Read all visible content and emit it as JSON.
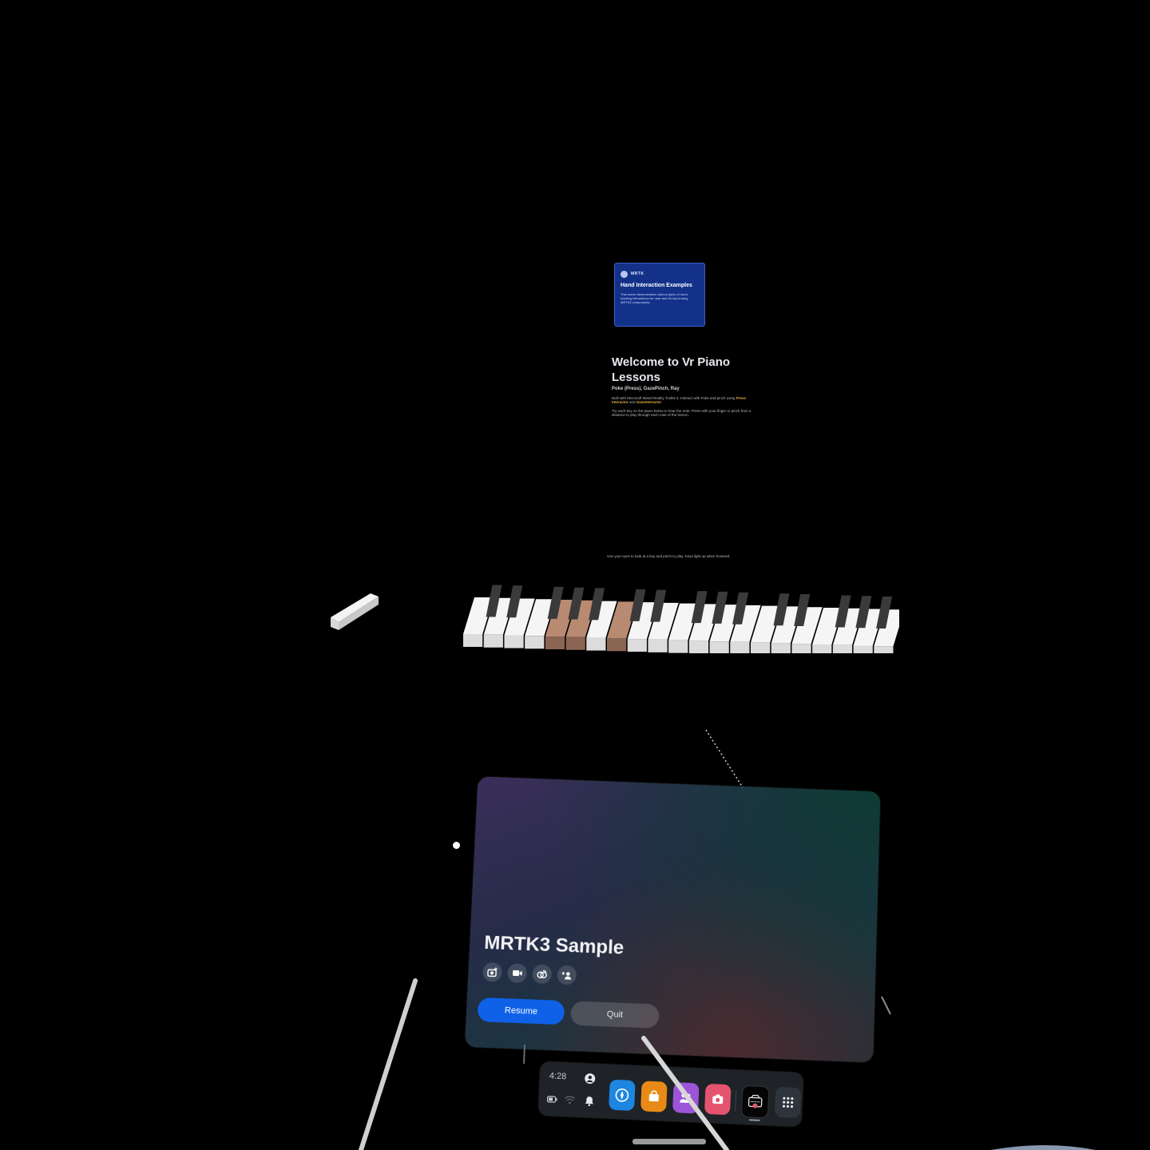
{
  "mrtk_card": {
    "brand": "MRTK",
    "title": "Hand Interaction Examples",
    "body": "This scene demonstrates various types of hand tracking interactions for near and far input using MRTK3 components."
  },
  "welcome": {
    "title": "Welcome to Vr Piano Lessons",
    "subtitle": "Poke (Press), GazePinch, Ray",
    "para1_a": "Built with Microsoft Mixed Reality Toolkit 3. Interact with Poke and pinch using ",
    "para1_link1": "Press Interactor",
    "para1_and": " and ",
    "para1_link2": "GazeInteractor",
    "para2": "Try each key on the piano below to hear the note. Press with your finger or pinch from a distance to play through each note of the lesson.",
    "footnote": "Use your eyes to look at a key and pinch to play. Keys light up when hovered."
  },
  "menu": {
    "title": "MRTK3 Sample",
    "icons": [
      "camera-add-icon",
      "video-record-icon",
      "cast-icon",
      "invite-people-icon"
    ],
    "resume_label": "Resume",
    "quit_label": "Quit"
  },
  "taskbar": {
    "time": "4:28",
    "apps": [
      "explore-icon",
      "store-icon",
      "people-icon",
      "camera-icon",
      "active-app-icon",
      "app-library-icon"
    ]
  },
  "colors": {
    "resume": "#0f62e8",
    "mrtk_card": "#14318a",
    "explore": "#1d86e0",
    "store": "#e98a17",
    "people": "#9b55d6",
    "camera": "#e5546f"
  }
}
